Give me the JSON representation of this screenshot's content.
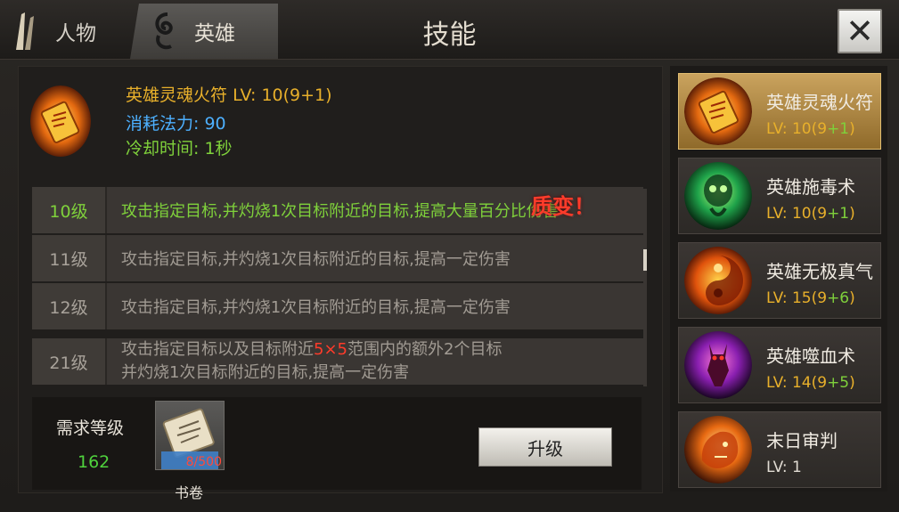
{
  "header": {
    "tabs": [
      {
        "label": "人物"
      },
      {
        "label": "英雄"
      }
    ],
    "title": "技能",
    "close_label": "✕"
  },
  "selected_skill": {
    "name": "英雄灵魂火符",
    "level_text": "LV: 10(9+1)",
    "mana_text": "消耗法力: 90",
    "cooldown_text": "冷却时间: 1秒"
  },
  "levels": [
    {
      "level": "10级",
      "desc": "攻击指定目标,并灼烧1次目标附近的目标,提高大量百分比伤害",
      "active": true
    },
    {
      "level": "11级",
      "desc": "攻击指定目标,并灼烧1次目标附近的目标,提高一定伤害"
    },
    {
      "level": "12级",
      "desc": "攻击指定目标,并灼烧1次目标附近的目标,提高一定伤害"
    },
    {
      "level": "21级",
      "desc_line1_a": "攻击指定目标以及目标附近",
      "desc_line1_red": "5×5",
      "desc_line1_b": "范围内的额外2个目标",
      "desc_line2": "并灼烧1次目标附近的目标,提高一定伤害"
    }
  ],
  "badge": "质变！",
  "requirements": {
    "level_label": "需求等级",
    "level_value": "162",
    "item_count": "8/500",
    "item_label": "书卷"
  },
  "upgrade_label": "升级",
  "skill_list": [
    {
      "name": "英雄灵魂火符",
      "lv_base": "LV: 10(9",
      "lv_plus": "+1",
      "lv_end": ")",
      "icon": "fire-talisman-icon",
      "selected": true
    },
    {
      "name": "英雄施毒术",
      "lv_base": "LV: 10(9",
      "lv_plus": "+1",
      "lv_end": ")",
      "icon": "poison-skull-icon"
    },
    {
      "name": "英雄无极真气",
      "lv_base": "LV: 15(9",
      "lv_plus": "+6",
      "lv_end": ")",
      "icon": "taiji-fire-icon"
    },
    {
      "name": "英雄噬血术",
      "lv_base": "LV: 14(9",
      "lv_plus": "+5",
      "lv_end": ")",
      "icon": "blood-demon-icon"
    },
    {
      "name": "末日审判",
      "lv_base": "LV: 1",
      "lv_plus": "",
      "lv_end": "",
      "icon": "fire-lion-icon"
    }
  ],
  "colors": {
    "gold": "#e8b02b",
    "green": "#7fd13b",
    "blue": "#4db0ff",
    "red": "#ff3b2a"
  }
}
